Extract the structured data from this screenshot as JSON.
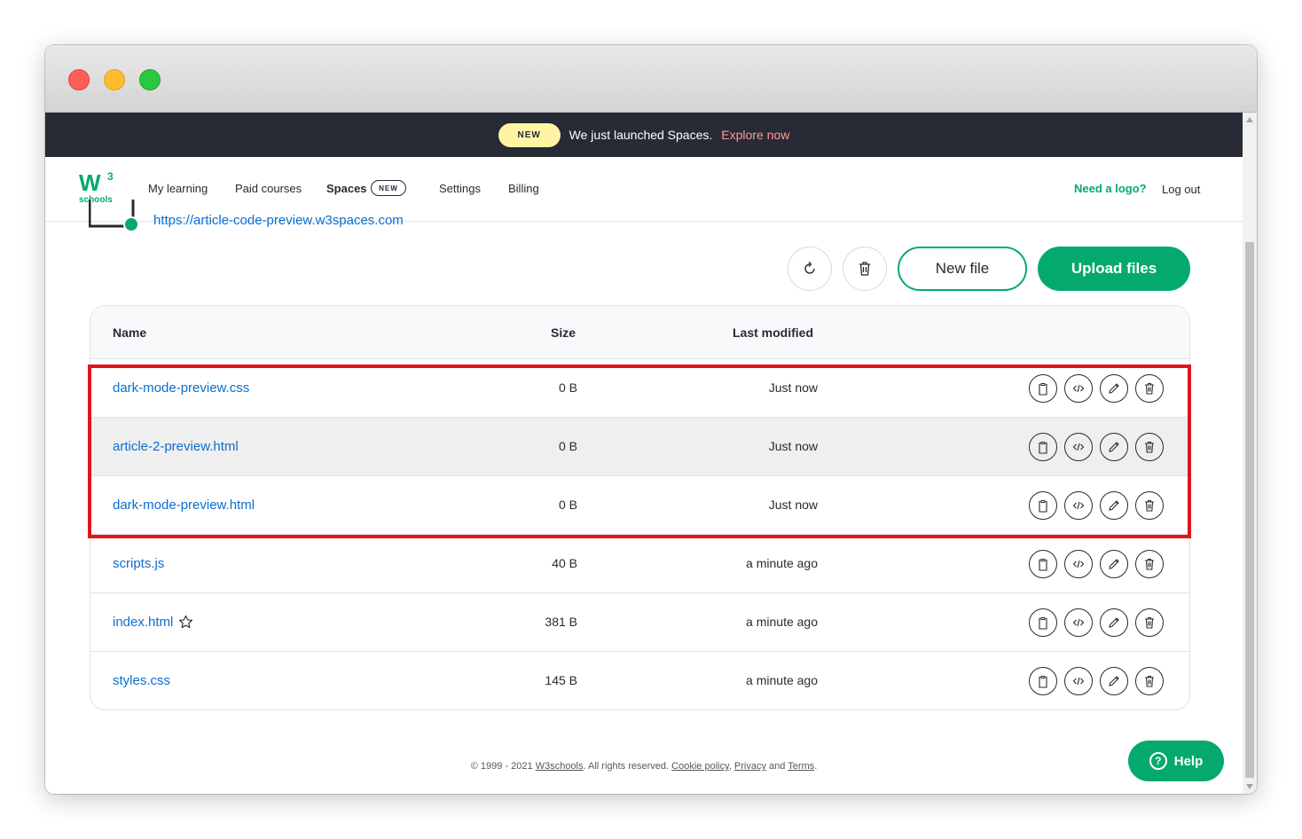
{
  "announcement": {
    "badge": "NEW",
    "message": "We just launched Spaces.",
    "link": "Explore now"
  },
  "logo": {
    "mark": "W",
    "superscript": "3",
    "text": "schools"
  },
  "nav": {
    "items": [
      "My learning",
      "Paid courses",
      "Spaces",
      "Settings",
      "Billing"
    ],
    "spaces_badge": "NEW",
    "need_logo": "Need a logo?",
    "logout": "Log out"
  },
  "space": {
    "url": "https://article-code-preview.w3spaces.com"
  },
  "toolbar": {
    "refresh_icon": "refresh-icon",
    "delete_icon": "trash-icon",
    "new_file": "New file",
    "upload_files": "Upload files"
  },
  "table": {
    "headers": {
      "name": "Name",
      "size": "Size",
      "modified": "Last modified"
    },
    "rows": [
      {
        "name": "dark-mode-preview.css",
        "size": "0 B",
        "modified": "Just now"
      },
      {
        "name": "article-2-preview.html",
        "size": "0 B",
        "modified": "Just now"
      },
      {
        "name": "dark-mode-preview.html",
        "size": "0 B",
        "modified": "Just now"
      },
      {
        "name": "scripts.js",
        "size": "40 B",
        "modified": "a minute ago"
      },
      {
        "name": "index.html",
        "size": "381 B",
        "modified": "a minute ago"
      },
      {
        "name": "styles.css",
        "size": "145 B",
        "modified": "a minute ago"
      }
    ],
    "row_actions": [
      "clipboard-icon",
      "code-icon",
      "pencil-icon",
      "trash-icon"
    ],
    "starred_row": "index.html",
    "hovered_row": "article-2-preview.html"
  },
  "footer": {
    "copyright": "© 1999 - 2021",
    "w3schools": "W3schools",
    "rights": ". All rights reserved.",
    "cookie": "Cookie policy",
    "privacy": "Privacy",
    "and": "and",
    "terms": "Terms",
    "period": "."
  },
  "help": {
    "label": "Help",
    "icon": "?"
  },
  "colors": {
    "brand_green": "#04aa6d",
    "dark": "#282a35",
    "link_blue": "#0a6ed1",
    "highlight_red": "#e0141e",
    "badge_yellow": "#fff4a3"
  }
}
